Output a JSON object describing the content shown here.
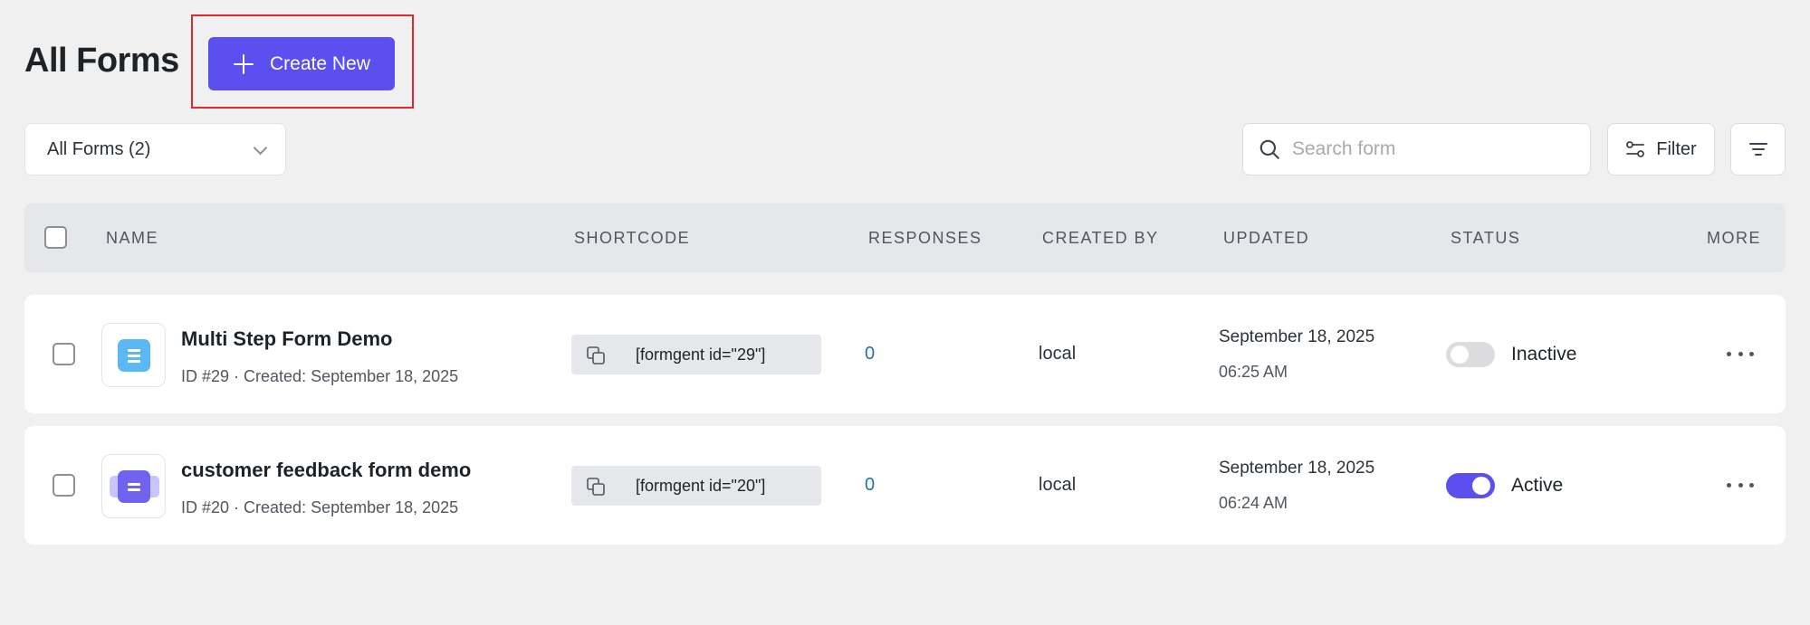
{
  "page": {
    "title": "All Forms"
  },
  "toolbar": {
    "create_label": "Create New",
    "filter_select_value": "All Forms (2)",
    "search_placeholder": "Search form",
    "filter_label": "Filter"
  },
  "table": {
    "headers": [
      "NAME",
      "SHORTCODE",
      "RESPONSES",
      "CREATED BY",
      "UPDATED",
      "STATUS",
      "MORE"
    ],
    "rows": [
      {
        "name": "Multi Step Form Demo",
        "meta": "ID #29 · Created: September 18, 2025",
        "shortcode": "[formgent id=\"29\"]",
        "responses": "0",
        "created_by": "local",
        "updated_date": "September 18, 2025",
        "updated_time": "06:25 AM",
        "status": "Inactive",
        "active": false
      },
      {
        "name": "customer feedback form demo",
        "meta": "ID #20 · Created: September 18, 2025",
        "shortcode": "[formgent id=\"20\"]",
        "responses": "0",
        "created_by": "local",
        "updated_date": "September 18, 2025",
        "updated_time": "06:24 AM",
        "status": "Active",
        "active": true
      }
    ]
  },
  "colors": {
    "accent": "#5b4ff0",
    "icon_blue": "#5ab8f5",
    "icon_purple": "#6f63f0",
    "highlight": "#e0282e"
  }
}
